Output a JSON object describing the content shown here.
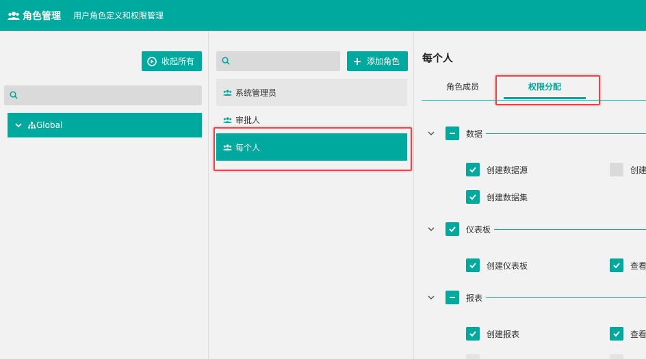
{
  "header": {
    "title": "角色管理",
    "subtitle": "用户角色定义和权限管理",
    "bg_color": "#00a99d"
  },
  "left_panel": {
    "collapse_button": "收起所有",
    "search": {
      "value": "",
      "placeholder": ""
    },
    "tree": [
      {
        "label": "Global",
        "expanded": true,
        "selected": true
      }
    ]
  },
  "middle_panel": {
    "search": {
      "value": "",
      "placeholder": ""
    },
    "add_button": "添加角色",
    "roles": [
      {
        "label": "系统管理员",
        "selected": false
      },
      {
        "label": "审批人",
        "selected": false
      },
      {
        "label": "每个人",
        "selected": true
      }
    ]
  },
  "right_panel": {
    "title": "每个人",
    "tabs": [
      {
        "label": "角色成员",
        "active": false
      },
      {
        "label": "权限分配",
        "active": true
      }
    ],
    "groups": [
      {
        "label": "数据",
        "state": "partial",
        "permissions": [
          {
            "label": "创建数据源",
            "checked": true
          },
          {
            "label": "创建",
            "checked": false
          },
          {
            "label": "创建数据集",
            "checked": true
          }
        ]
      },
      {
        "label": "仪表板",
        "state": "checked",
        "permissions": [
          {
            "label": "创建仪表板",
            "checked": true
          },
          {
            "label": "查看",
            "checked": true
          }
        ]
      },
      {
        "label": "报表",
        "state": "partial",
        "permissions": [
          {
            "label": "创建报表",
            "checked": true
          },
          {
            "label": "查看",
            "checked": true
          }
        ]
      }
    ]
  },
  "colors": {
    "accent": "#00a99d",
    "highlight": "#e0474c"
  }
}
